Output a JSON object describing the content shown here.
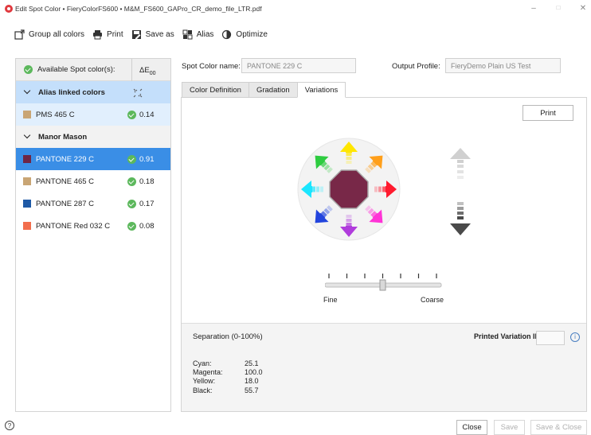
{
  "window": {
    "title": "Edit Spot Color • FieryColorFS600 • M&M_FS600_GAPro_CR_demo_file_LTR.pdf",
    "controls": [
      "–",
      "□",
      "✕"
    ]
  },
  "toolbar": {
    "group_all": "Group all colors",
    "print": "Print",
    "save_as": "Save as",
    "alias": "Alias",
    "optimize": "Optimize"
  },
  "left_panel": {
    "header_label": "Available Spot color(s):",
    "header_delta_e": "ΔE",
    "header_delta_sub": "00",
    "groups": [
      {
        "name": "Alias linked colors",
        "items": [
          {
            "name": "PMS 465 C",
            "value": "0.14",
            "swatch": "#c9a574"
          }
        ]
      },
      {
        "name": "Manor Mason",
        "items": [
          {
            "name": "PANTONE 229 C",
            "value": "0.91",
            "swatch": "#6e2544"
          },
          {
            "name": "PANTONE 465 C",
            "value": "0.18",
            "swatch": "#c9a574"
          },
          {
            "name": "PANTONE 287 C",
            "value": "0.17",
            "swatch": "#1f5aa6"
          },
          {
            "name": "PANTONE Red 032 C",
            "value": "0.08",
            "swatch": "#f26e4d"
          }
        ]
      }
    ]
  },
  "form": {
    "spot_name_label": "Spot Color name:",
    "spot_name_value": "PANTONE 229 C",
    "output_profile_label": "Output Profile:",
    "output_profile_value": "FieryDemo Plain US Test"
  },
  "tabs": [
    {
      "label": "Color Definition",
      "active": false
    },
    {
      "label": "Gradation",
      "active": false
    },
    {
      "label": "Variations",
      "active": true
    }
  ],
  "variations": {
    "print_label": "Print",
    "center_color": "#782848",
    "arrows": {
      "up": "#ffe600",
      "up_right": "#ff9f1a",
      "right": "#ff1a2e",
      "down_right": "#ff33d6",
      "down": "#b03cdc",
      "down_left": "#2244dd",
      "left": "#1ae6ff",
      "up_left": "#2ecc40"
    },
    "lightness_up": "#d0d0d0",
    "lightness_down": "#4a4a4a",
    "slider_fine": "Fine",
    "slider_coarse": "Coarse",
    "slider_value": 0.5
  },
  "separation": {
    "title": "Separation (0-100%)",
    "printed_variation_label": "Printed Variation ID:",
    "printed_variation_value": "",
    "rows": [
      {
        "label": "Cyan:",
        "value": "25.1"
      },
      {
        "label": "Magenta:",
        "value": "100.0"
      },
      {
        "label": "Yellow:",
        "value": "18.0"
      },
      {
        "label": "Black:",
        "value": "55.7"
      }
    ]
  },
  "footer": {
    "close": "Close",
    "save": "Save",
    "save_close": "Save & Close"
  }
}
